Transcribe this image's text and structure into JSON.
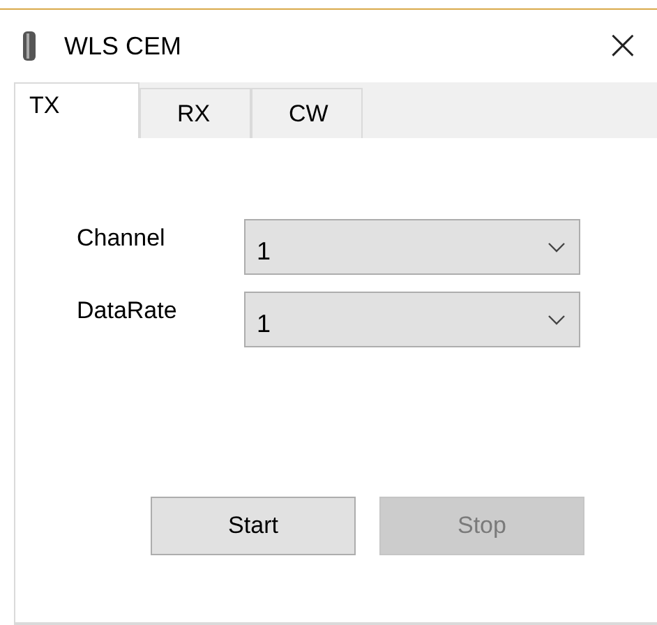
{
  "window": {
    "title": "WLS CEM",
    "close": "×"
  },
  "tabs": [
    {
      "label": "TX",
      "selected": true
    },
    {
      "label": "RX",
      "selected": false
    },
    {
      "label": "CW",
      "selected": false
    }
  ],
  "fields": [
    {
      "label": "Channel",
      "value": "1"
    },
    {
      "label": "DataRate",
      "value": "1"
    }
  ],
  "buttons": [
    {
      "label": "Start",
      "disabled": false
    },
    {
      "label": "Stop",
      "disabled": true
    }
  ]
}
